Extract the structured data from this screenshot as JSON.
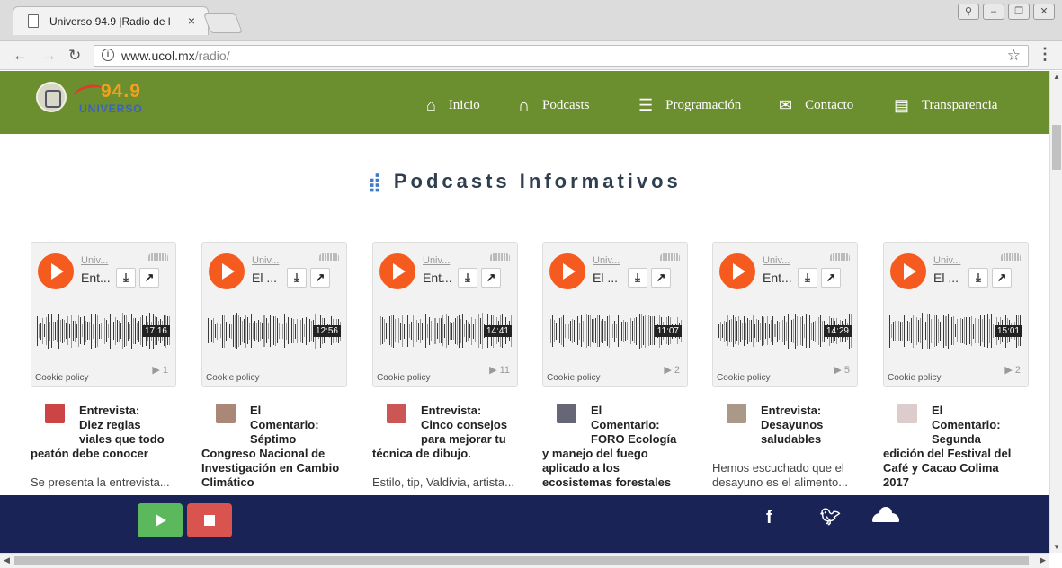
{
  "browser": {
    "tab_title": "Universo 94.9 |Radio de l",
    "url_domain": "www.ucol.mx",
    "url_path": "/radio/"
  },
  "site": {
    "logo": {
      "frequency": "94.9",
      "name": "UNIVERSO"
    },
    "nav": [
      {
        "label": "Inicio",
        "icon": "home-icon"
      },
      {
        "label": "Podcasts",
        "icon": "headphones-icon"
      },
      {
        "label": "Programación",
        "icon": "list-icon"
      },
      {
        "label": "Contacto",
        "icon": "envelope-icon"
      },
      {
        "label": "Transparencia",
        "icon": "document-icon"
      }
    ],
    "section_title": "Podcasts Informativos"
  },
  "podcasts": [
    {
      "user": "Univ...",
      "track": "Ent...",
      "duration": "17:16",
      "plays": "▶ 1",
      "cookie": "Cookie policy",
      "title_lines": [
        "Entrevista:",
        "Diez reglas",
        "viales que todo",
        "peatón debe conocer"
      ],
      "desc": "Se presenta la entrevista..."
    },
    {
      "user": "Univ...",
      "track": "El ...",
      "duration": "12:56",
      "plays": "",
      "cookie": "Cookie policy",
      "title_lines": [
        "El",
        "Comentario:",
        "Séptimo",
        "Congreso Nacional de",
        "Investigación en Cambio",
        "Climático"
      ],
      "desc": ""
    },
    {
      "user": "Univ...",
      "track": "Ent...",
      "duration": "14:41",
      "plays": "▶ 11",
      "cookie": "Cookie policy",
      "title_lines": [
        "Entrevista:",
        "Cinco consejos",
        "para mejorar tu",
        "técnica de dibujo."
      ],
      "desc": "Estilo, tip, Valdivia, artista..."
    },
    {
      "user": "Univ...",
      "track": "El ...",
      "duration": "11:07",
      "plays": "▶ 2",
      "cookie": "Cookie policy",
      "title_lines": [
        "El",
        "Comentario:",
        "FORO Ecología",
        "y manejo del fuego",
        "aplicado a los",
        "ecosistemas forestales"
      ],
      "desc": ""
    },
    {
      "user": "Univ...",
      "track": "Ent...",
      "duration": "14:29",
      "plays": "▶ 5",
      "cookie": "Cookie policy",
      "title_lines": [
        "Entrevista:",
        "Desayunos",
        "saludables"
      ],
      "desc": "Hemos escuchado que el desayuno es el alimento..."
    },
    {
      "user": "Univ...",
      "track": "El ...",
      "duration": "15:01",
      "plays": "▶ 2",
      "cookie": "Cookie policy",
      "title_lines": [
        "El",
        "Comentario:",
        "Segunda",
        "edición del Festival del",
        "Café y Cacao Colima",
        "2017"
      ],
      "desc": ""
    }
  ],
  "colors": {
    "nav_bg": "#6b8e2f",
    "player_bar_bg": "#1a2355",
    "play_green": "#5cb85c",
    "stop_red": "#d9534f",
    "soundcloud_orange": "#f55a1e",
    "title_icon_blue": "#3b7bc8"
  },
  "footer": {
    "social": [
      "facebook-icon",
      "twitter-icon",
      "soundcloud-icon"
    ]
  }
}
